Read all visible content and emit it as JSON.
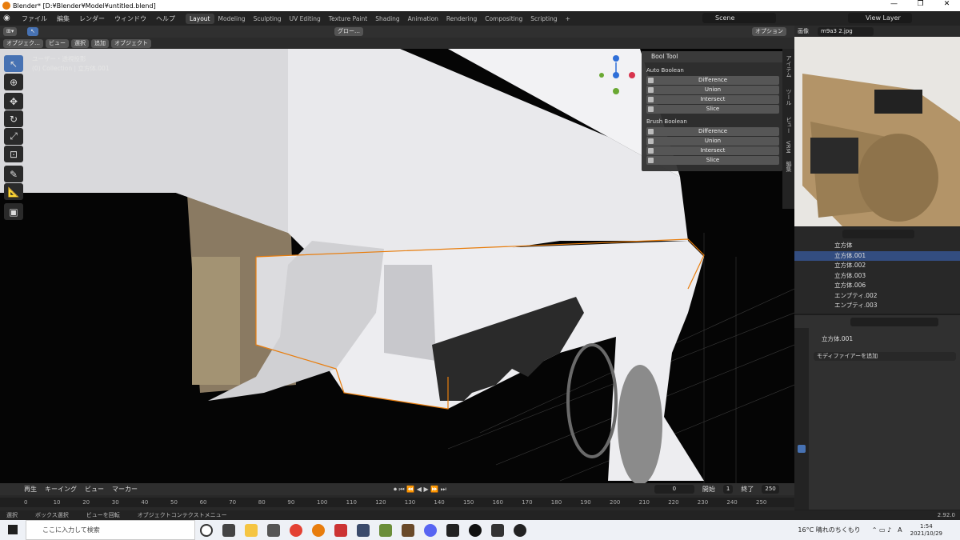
{
  "window": {
    "title": "Blender* [D:¥Blender¥Model¥untitled.blend]",
    "minimize": "—",
    "maximize": "❐",
    "close": "✕"
  },
  "menu": [
    "ファイル",
    "編集",
    "レンダー",
    "ウィンドウ",
    "ヘルプ"
  ],
  "workspaces": [
    "Layout",
    "Modeling",
    "Sculpting",
    "UV Editing",
    "Texture Paint",
    "Shading",
    "Animation",
    "Rendering",
    "Compositing",
    "Scripting",
    "+"
  ],
  "active_workspace": "Layout",
  "scene": "Scene",
  "view_layer": "View Layer",
  "header2": {
    "orientation": "グロー…",
    "options": "オプション"
  },
  "header3": {
    "mode": "オブジェク…",
    "items": [
      "ビュー",
      "選択",
      "追加",
      "オブジェクト"
    ]
  },
  "viewport": {
    "view_name": "ユーザー・透視投影",
    "collection": "(0) Collection | 立方体.001"
  },
  "bool_tool": {
    "title": "Bool Tool",
    "auto_title": "Auto Boolean",
    "auto": [
      "Difference",
      "Union",
      "Intersect",
      "Slice"
    ],
    "brush_title": "Brush Boolean",
    "brush": [
      "Difference",
      "Union",
      "Intersect",
      "Slice"
    ]
  },
  "side_tabs": [
    "アイテム",
    "ツール",
    "ビュー",
    "VRM",
    "編集"
  ],
  "image_editor": {
    "label": "画像",
    "file": "m9a3 2.jpg"
  },
  "outliner": {
    "rows": [
      {
        "name": "立方体",
        "selected": false
      },
      {
        "name": "立方体.001",
        "selected": true
      },
      {
        "name": "立方体.002",
        "selected": false
      },
      {
        "name": "立方体.003",
        "selected": false
      },
      {
        "name": "立方体.006",
        "selected": false
      },
      {
        "name": "エンプティ.002",
        "selected": false
      },
      {
        "name": "エンプティ.003",
        "selected": false
      }
    ]
  },
  "properties": {
    "object": "立方体.001",
    "add_modifier": "モディファイアーを追加"
  },
  "timeline": {
    "menu": [
      "再生",
      "キーイング",
      "ビュー",
      "マーカー"
    ],
    "current": "0",
    "start_label": "開始",
    "start": "1",
    "end_label": "終了",
    "end": "250",
    "ticks": [
      "0",
      "10",
      "20",
      "30",
      "40",
      "50",
      "60",
      "70",
      "80",
      "90",
      "100",
      "110",
      "120",
      "130",
      "140",
      "150",
      "160",
      "170",
      "180",
      "190",
      "200",
      "210",
      "220",
      "230",
      "240",
      "250"
    ]
  },
  "status": {
    "items": [
      "選択",
      "ボックス選択",
      "ビューを回転",
      "オブジェクトコンテクストメニュー"
    ],
    "version": "2.92.0"
  },
  "taskbar": {
    "search": "ここに入力して検索",
    "weather": "16°C 晴れのちくもり",
    "ime": "A",
    "time": "1:54",
    "date": "2021/10/29"
  },
  "colors": {
    "accent": "#4772b3",
    "selection": "#e87d0d",
    "bg": "#1d1d1d"
  }
}
